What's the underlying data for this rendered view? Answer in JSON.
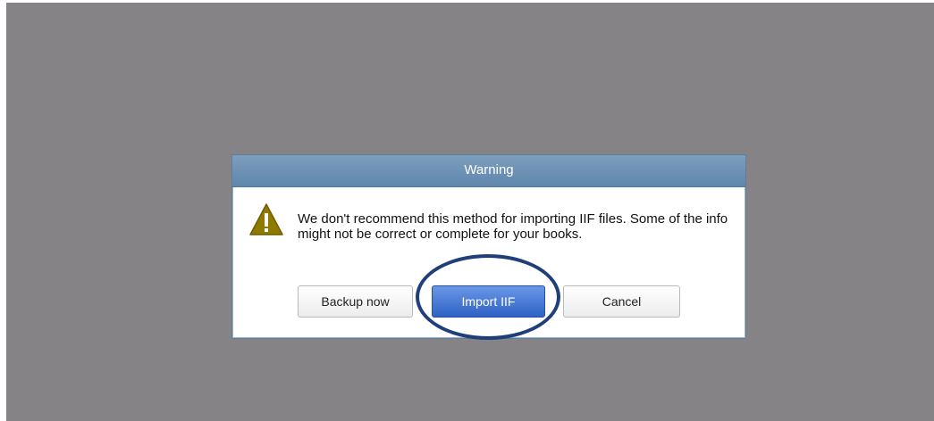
{
  "dialog": {
    "title": "Warning",
    "icon": "warning-triangle-icon",
    "message": "We don't recommend this method for importing IIF files. Some of the info might not be correct or complete for your books.",
    "buttons": {
      "backup_label": "Backup now",
      "import_label": "Import IIF",
      "cancel_label": "Cancel"
    }
  },
  "colors": {
    "backdrop": "#858385",
    "titlebar": "#6f93b6",
    "primary_button": "#3f72d4",
    "highlight_ring": "#1f3f7a",
    "warning_icon": "#8f7a00"
  }
}
